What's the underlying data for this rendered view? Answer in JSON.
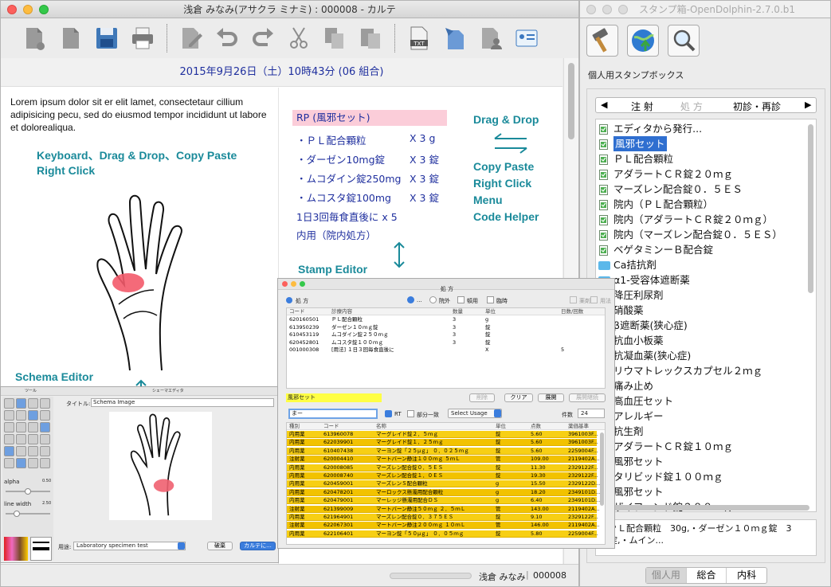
{
  "karte": {
    "title": "浅倉 みなみ(アサクラ ミナミ) : 000008 - カルテ",
    "date_header": "2015年9月26日（土）10時43分 (06 組合)",
    "lorem": "Lorem ipsum dolor sit er elit lamet, consectetaur cillium adipisicing pecu, sed do eiusmod tempor incididunt ut labore et dolorealiqua.",
    "hint_keyboard": "Keyboard、Drag & Drop、Copy Paste",
    "hint_rightclick": "Right Click",
    "hint_schema": "Schema Editor",
    "hint_dragdrop": "Drag & Drop",
    "hint_menu": [
      "Copy Paste",
      "Right Click",
      "Menu",
      "Code Helper"
    ],
    "hint_stamp": "Stamp Editor",
    "rx_title": "RP (風邪セット)",
    "rx_lines": [
      {
        "name": "・ＰＬ配合顆粒",
        "qty": "X 3  g"
      },
      {
        "name": "・ダーゼン10mg錠",
        "qty": "X 3  錠"
      },
      {
        "name": "・ムコダイン錠250mg",
        "qty": "X 3  錠"
      },
      {
        "name": "・ムコスタ錠100mg",
        "qty": "X 3  錠"
      }
    ],
    "rx_usage": "1日3回毎食直後に x 5",
    "rx_note": "内用（院内処方）",
    "status_patient": "浅倉 みなみ",
    "status_id": "000008"
  },
  "schema": {
    "window_title": "シェーマエディタ",
    "tools_title": "ツール",
    "title_label": "タイトル:",
    "title_value": "Schema Image",
    "alpha_label": "alpha",
    "alpha_value": "0.50",
    "linewidth_label": "line width",
    "linewidth_value": "2.50",
    "usage_label": "用途:",
    "usage_value": "Laboratory specimen test",
    "discard_btn": "破棄",
    "karte_btn": "カルテに..."
  },
  "stamp_editor": {
    "window_title": "処 方",
    "section": "処 方",
    "radio_options": [
      "...",
      "院外"
    ],
    "checkbox_options": [
      "頓用",
      "臨時"
    ],
    "right_checks": [
      "薬剤",
      "用法"
    ],
    "headers": [
      "コード",
      "診療内容",
      "数量",
      "単位",
      "日数/回数"
    ],
    "rows": [
      [
        "620160501",
        "ＰＬ配合顆粒",
        "3",
        "g",
        ""
      ],
      [
        "613950239",
        "ダーゼン１０ｍｇ錠",
        "3",
        "錠",
        ""
      ],
      [
        "610453119",
        "ムコダイン錠２５０ｍｇ",
        "3",
        "錠",
        ""
      ],
      [
        "620452801",
        "ムコスタ錠１００ｍｇ",
        "3",
        "錠",
        ""
      ],
      [
        "001000308",
        "[用法] １日３回毎食直後に",
        "",
        "X",
        "5"
      ]
    ],
    "stamp_name": "風邪セット",
    "buttons": [
      "削除",
      "クリア",
      "展開",
      "展開継続"
    ],
    "search_value": "まー",
    "rt_label": "RT",
    "partial_label": "部分一致",
    "select_usage": "Select Usage",
    "count_label": "件数",
    "count_value": "24",
    "result_headers": [
      "種別",
      "コード",
      "名称",
      "単位",
      "点数",
      "薬価基準"
    ],
    "results": [
      [
        "内用薬",
        "613960078",
        "マーグレイド錠２．５ｍｇ",
        "錠",
        "5.60",
        "3961003F..."
      ],
      [
        "内用薬",
        "622039901",
        "マーグレイド錠１．２５ｍｇ",
        "錠",
        "5.60",
        "3961003F..."
      ],
      [
        "内用薬",
        "610407438",
        "マーヨン錠「２５μｇ」 ０．０２５ｍｇ",
        "錠",
        "5.60",
        "2259004F..."
      ],
      [
        "注射薬",
        "620004410",
        "マートバーン静注１００ｍｇ ５ｍＬ",
        "管",
        "109.00",
        "2119402A..."
      ],
      [
        "内用薬",
        "620008085",
        "マーズレン配合錠０．５ＥＳ",
        "錠",
        "11.30",
        "2329122F..."
      ],
      [
        "内用薬",
        "620008740",
        "マーズレン配合錠１．０ＥＳ",
        "錠",
        "19.30",
        "2329122F..."
      ],
      [
        "内用薬",
        "620459001",
        "マーズレンＳ配合顆粒",
        "g",
        "15.50",
        "2329122D..."
      ],
      [
        "内用薬",
        "620478201",
        "マーロックス懸濁用配合顆粒",
        "g",
        "18.20",
        "2349101D..."
      ],
      [
        "内用薬",
        "620479001",
        "マーレッジ懸濁用配合ＤＳ",
        "g",
        "6.40",
        "2349101D..."
      ],
      [
        "注射薬",
        "621399009",
        "マートバーン静注５０ｍｇ ２．５ｍＬ",
        "管",
        "143.00",
        "2119402A..."
      ],
      [
        "内用薬",
        "621964901",
        "マーズレン配合錠０．３７５ＥＳ",
        "錠",
        "9.10",
        "2329122F..."
      ],
      [
        "注射薬",
        "622067301",
        "マートバーン静注２００ｍｇ １０ｍＬ",
        "管",
        "146.00",
        "2119402A..."
      ],
      [
        "内用薬",
        "622106401",
        "マーヨン錠「５０μｇ」 ０．０５ｍｇ",
        "錠",
        "5.80",
        "2259004F..."
      ]
    ]
  },
  "stampbox": {
    "title": "スタンプ箱-OpenDolphin-2.7.0.b1",
    "section_label": "個人用スタンプボックス",
    "tabs": [
      "注 射",
      "処 方",
      "初診・再診"
    ],
    "items": [
      {
        "label": "エディタから発行...",
        "type": "stamp"
      },
      {
        "label": "風邪セット",
        "type": "stamp",
        "selected": true
      },
      {
        "label": "ＰＬ配合顆粒",
        "type": "stamp"
      },
      {
        "label": "アダラートＣＲ錠２０ｍｇ",
        "type": "stamp"
      },
      {
        "label": "マーズレン配合錠０．５ＥＳ",
        "type": "stamp"
      },
      {
        "label": "院内（ＰＬ配合顆粒）",
        "type": "stamp"
      },
      {
        "label": "院内（アダラートＣＲ錠２０ｍｇ）",
        "type": "stamp"
      },
      {
        "label": "院内（マーズレン配合錠０．５ＥＳ）",
        "type": "stamp"
      },
      {
        "label": "ベゲタミンーＢ配合錠",
        "type": "stamp"
      },
      {
        "label": "Ca拮抗剤",
        "type": "folder"
      },
      {
        "label": "α1-受容体遮断薬",
        "type": "folder"
      },
      {
        "label": "降圧利尿剤",
        "type": "folder"
      },
      {
        "label": "硝酸薬",
        "type": "folder"
      },
      {
        "label": "β遮断薬(狭心症)",
        "type": "folder"
      },
      {
        "label": "抗血小板薬",
        "type": "folder"
      },
      {
        "label": "抗凝血薬(狭心症)",
        "type": "folder"
      },
      {
        "label": "リウマトレックスカプセル２ｍｇ",
        "type": "stamp"
      },
      {
        "label": "痛み止め",
        "type": "stamp"
      },
      {
        "label": "高血圧セット",
        "type": "stamp"
      },
      {
        "label": "アレルギー",
        "type": "stamp"
      },
      {
        "label": "抗生剤",
        "type": "stamp"
      },
      {
        "label": "アダラートＣＲ錠１０ｍｇ",
        "type": "stamp"
      },
      {
        "label": "風邪セット",
        "type": "stamp"
      },
      {
        "label": "タリビッド錠１００ｍｇ",
        "type": "stamp"
      },
      {
        "label": "風邪セット",
        "type": "stamp"
      },
      {
        "label": "ザイフーンド錠２００ｍｇ",
        "type": "stamp"
      }
    ],
    "preview": "ＰＬ配合顆粒　30g,・ダーゼン１０ｍｇ錠　3錠,・ムイン...",
    "bottom_tabs": [
      "個人用",
      "総合",
      "内科"
    ]
  }
}
